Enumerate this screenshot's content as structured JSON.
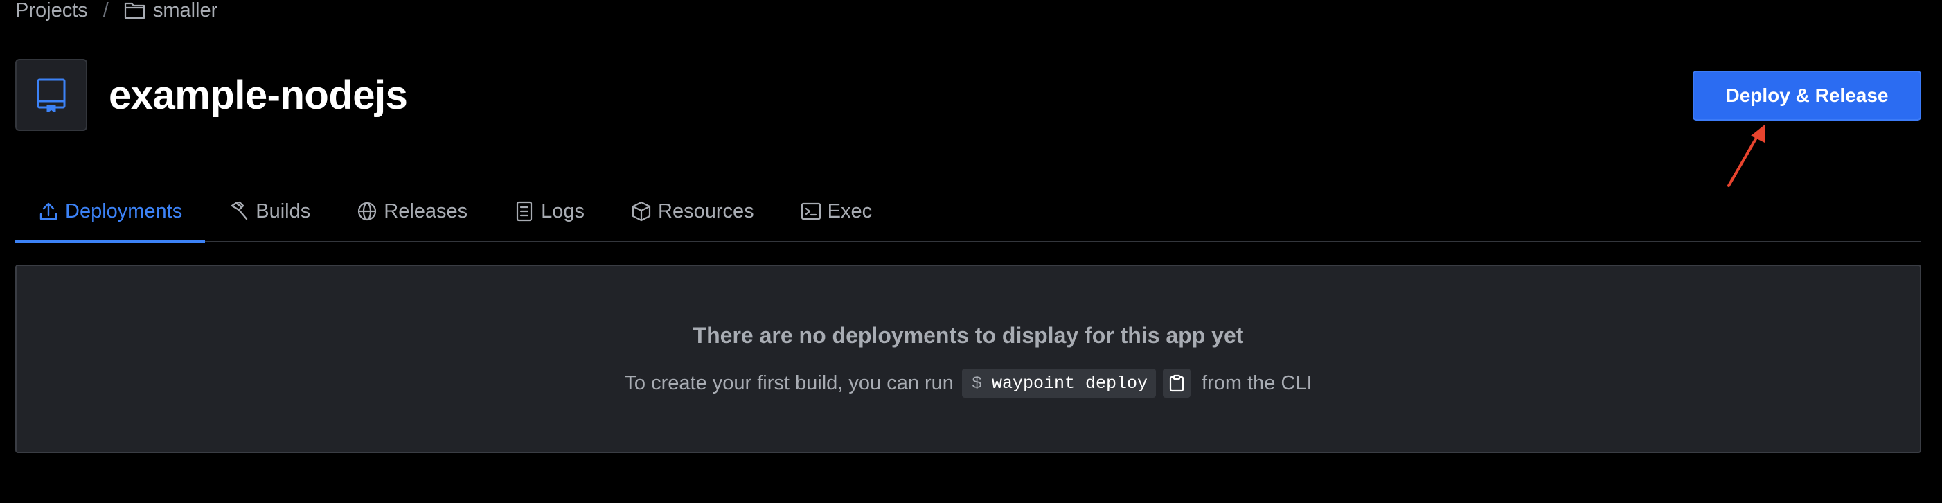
{
  "breadcrumb": {
    "root": "Projects",
    "separator": "/",
    "current": "smaller"
  },
  "header": {
    "app_name": "example-nodejs",
    "deploy_button_label": "Deploy & Release"
  },
  "tabs": [
    {
      "label": "Deployments",
      "icon": "upload-icon",
      "active": true
    },
    {
      "label": "Builds",
      "icon": "hammer-icon",
      "active": false
    },
    {
      "label": "Releases",
      "icon": "globe-icon",
      "active": false
    },
    {
      "label": "Logs",
      "icon": "document-list-icon",
      "active": false
    },
    {
      "label": "Resources",
      "icon": "box-icon",
      "active": false
    },
    {
      "label": "Exec",
      "icon": "terminal-icon",
      "active": false
    }
  ],
  "empty_state": {
    "title": "There are no deployments to display for this app yet",
    "hint_before": "To create your first build, you can run",
    "command_prompt": "$",
    "command": "waypoint deploy",
    "hint_after": "from the CLI"
  },
  "colors": {
    "background": "#000000",
    "accent": "#2b6cf2",
    "active_tab": "#3c82f6",
    "panel": "#212328",
    "annotation_arrow": "#e8442e"
  }
}
